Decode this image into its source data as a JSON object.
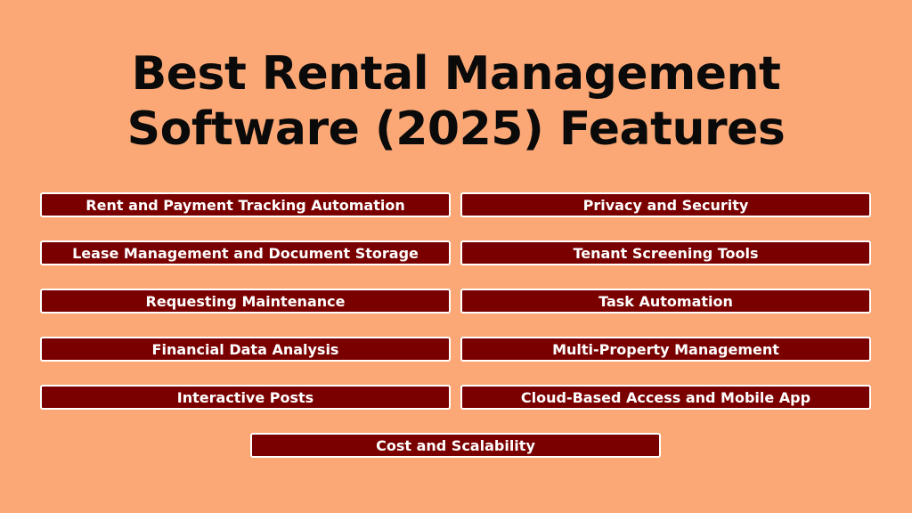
{
  "title": {
    "line1": "Best Rental Management",
    "line2": "Software (2025) Features"
  },
  "colors": {
    "background": "#fba876",
    "box_fill": "#7a0000",
    "box_border": "#ffffff",
    "box_text": "#ffffff",
    "title_text": "#0a0a0a"
  },
  "features": {
    "left": [
      "Rent and Payment Tracking Automation",
      "Lease Management and Document Storage",
      "Requesting Maintenance",
      "Financial Data Analysis",
      "Interactive Posts"
    ],
    "right": [
      "Privacy and Security",
      "Tenant Screening Tools",
      "Task Automation",
      "Multi-Property Management",
      "Cloud-Based Access and Mobile App"
    ],
    "bottom": "Cost and Scalability"
  }
}
